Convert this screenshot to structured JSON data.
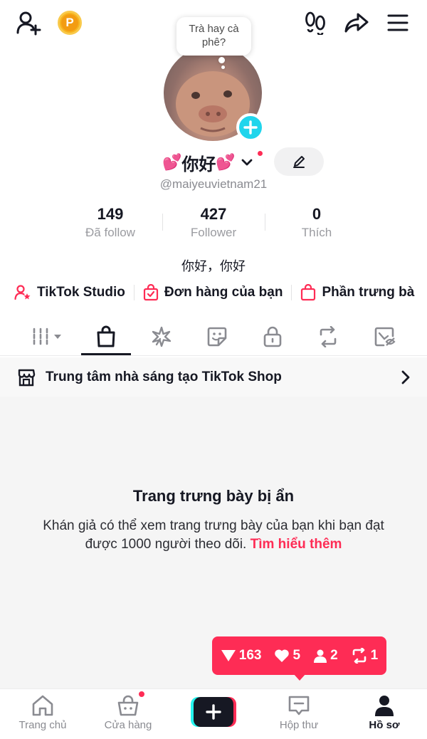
{
  "note": {
    "text": "Trà hay cà phê?"
  },
  "profile": {
    "name_left_heart": "💕",
    "name": "你好",
    "name_right_heart": "💕",
    "username": "@maiyeuvietnam21",
    "bio": "你好，你好"
  },
  "stats": [
    {
      "value": "149",
      "label": "Đã follow"
    },
    {
      "value": "427",
      "label": "Follower"
    },
    {
      "value": "0",
      "label": "Thích"
    }
  ],
  "quick_links": [
    {
      "label": "TikTok Studio",
      "icon": "person-star-icon"
    },
    {
      "label": "Đơn hàng của bạn",
      "icon": "order-bag-icon"
    },
    {
      "label": "Phần trưng bà",
      "icon": "showcase-bag-icon"
    }
  ],
  "tabs": [
    {
      "icon": "grid-icon",
      "active": false
    },
    {
      "icon": "shopping-bag-icon",
      "active": true
    },
    {
      "icon": "sparkle-icon",
      "active": false
    },
    {
      "icon": "sticker-icon",
      "active": false
    },
    {
      "icon": "lock-icon",
      "active": false
    },
    {
      "icon": "repost-icon",
      "active": false
    },
    {
      "icon": "liked-hidden-icon",
      "active": false
    }
  ],
  "shop_banner": {
    "label": "Trung tâm nhà sáng tạo TikTok Shop"
  },
  "empty_state": {
    "title": "Trang trưng bày bị ẩn",
    "body": "Khán giả có thể xem trang trưng bày của bạn khi bạn đạt được 1000 người theo dõi.",
    "link": "Tìm hiểu thêm"
  },
  "notification": {
    "views": "163",
    "likes": "5",
    "followers": "2",
    "reposts": "1"
  },
  "bottom_nav": [
    {
      "label": "Trang chủ",
      "active": false
    },
    {
      "label": "Cửa hàng",
      "active": false
    },
    {
      "label": "Hộp thư",
      "active": false
    },
    {
      "label": "Hồ sơ",
      "active": true
    }
  ],
  "colors": {
    "accent": "#fe2c55",
    "cyan": "#25f4ee",
    "text": "#161823",
    "muted": "#8a8b91"
  }
}
